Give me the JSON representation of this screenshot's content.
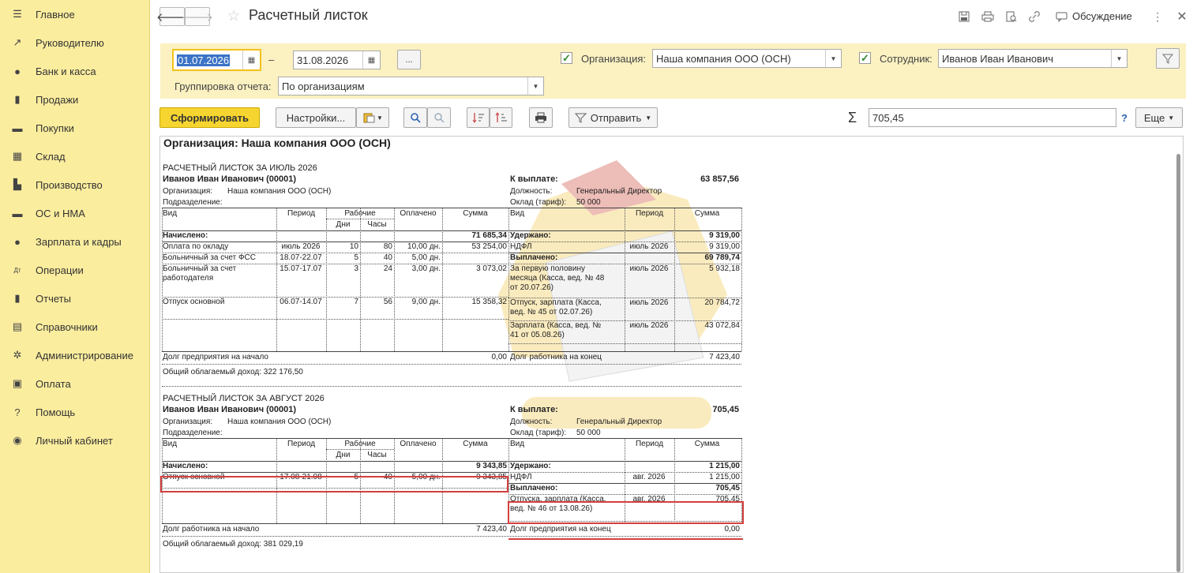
{
  "sidebar": {
    "items": [
      {
        "label": "Главное",
        "icon": "menu-icon"
      },
      {
        "label": "Руководителю",
        "icon": "trend-icon"
      },
      {
        "label": "Банк и касса",
        "icon": "coin-icon"
      },
      {
        "label": "Продажи",
        "icon": "bag-icon"
      },
      {
        "label": "Покупки",
        "icon": "cart-icon"
      },
      {
        "label": "Склад",
        "icon": "warehouse-icon"
      },
      {
        "label": "Производство",
        "icon": "factory-icon"
      },
      {
        "label": "ОС и НМА",
        "icon": "truck-icon"
      },
      {
        "label": "Зарплата и кадры",
        "icon": "person-icon"
      },
      {
        "label": "Операции",
        "icon": "debit-credit-icon"
      },
      {
        "label": "Отчеты",
        "icon": "bar-chart-icon"
      },
      {
        "label": "Справочники",
        "icon": "books-icon"
      },
      {
        "label": "Администрирование",
        "icon": "gear-icon"
      },
      {
        "label": "Оплата",
        "icon": "wallet-icon"
      },
      {
        "label": "Помощь",
        "icon": "question-icon"
      },
      {
        "label": "Личный кабинет",
        "icon": "user-circle-icon"
      }
    ]
  },
  "header": {
    "title": "Расчетный листок",
    "discussion": "Обсуждение"
  },
  "filters": {
    "date_from": "01.07.2026",
    "date_to": "31.08.2026",
    "dash": "–",
    "dots": "...",
    "org_label": "Организация:",
    "org_value": "Наша компания ООО (ОСН)",
    "emp_label": "Сотрудник:",
    "emp_value": "Иванов Иван Иванович",
    "group_label": "Группировка отчета:",
    "group_value": "По организациям"
  },
  "toolbar": {
    "generate": "Сформировать",
    "settings": "Настройки...",
    "send": "Отправить",
    "sum_symbol": "Σ",
    "sum_value": "705,45",
    "help": "?",
    "more": "Еще"
  },
  "report": {
    "org_header": "Организация: Наша компания ООО (ОСН)",
    "col_type": "Вид",
    "col_period": "Период",
    "col_work": "Рабочие",
    "col_days": "Дни",
    "col_hours": "Часы",
    "col_paid": "Оплачено",
    "col_sum": "Сумма",
    "to_pay_label": "К выплате:",
    "position_label": "Должность:",
    "position_value": "Генеральный Директор",
    "salary_label": "Оклад (тариф):",
    "salary_value": "50 000",
    "org_label": "Организация:",
    "org_value": "Наша компания ООО (ОСН)",
    "dept_label": "Подразделение:",
    "accrued": "Начислено:",
    "withheld": "Удержано:",
    "paid_out": "Выплачено:",
    "july": {
      "title": "РАСЧЕТНЫЙ ЛИСТОК ЗА ИЮЛЬ 2026",
      "employee": "Иванов Иван Иванович (00001)",
      "to_pay": "63 857,56",
      "accrued_total": "71 685,34",
      "withheld_total": "9 319,00",
      "paid_total": "69 789,74",
      "left": [
        {
          "type": "Оплата по окладу",
          "period": "июль 2026",
          "days": "10",
          "hours": "80",
          "paid": "10,00 дн.",
          "sum": "53 254,00"
        },
        {
          "type": "Больничный за счет ФСС",
          "period": "18.07-22.07",
          "days": "5",
          "hours": "40",
          "paid": "5,00 дн.",
          "sum": ""
        },
        {
          "type": "Больничный за счет",
          "type2": "работодателя",
          "period": "15.07-17.07",
          "days": "3",
          "hours": "24",
          "paid": "3,00 дн.",
          "sum": "3 073,02"
        },
        {
          "type": "Отпуск основной",
          "period": "06.07-14.07",
          "days": "7",
          "hours": "56",
          "paid": "9,00 дн.",
          "sum": "15 358,32"
        }
      ],
      "ndfl": {
        "type": "НДФЛ",
        "period": "июль 2026",
        "sum": "9 319,00"
      },
      "payments": [
        {
          "l1": "За первую половину",
          "l2": "месяца (Касса, вед. № 48",
          "l3": "от 20.07.26)",
          "period": "июль 2026",
          "sum": "5 932,18"
        },
        {
          "l1": "Отпуск, зарплата (Касса,",
          "l2": "вед. № 45 от 02.07.26)",
          "period": "июль 2026",
          "sum": "20 784,72"
        },
        {
          "l1": "Зарплата (Касса, вед. №",
          "l2": "41 от 05.08.26)",
          "period": "июль 2026",
          "sum": "43 072,84"
        }
      ],
      "debt_start_label": "Долг предприятия на начало",
      "debt_start": "0,00",
      "debt_end_label": "Долг работника на конец",
      "debt_end": "7 423,40",
      "income": "Общий облагаемый доход: 322 176,50"
    },
    "august": {
      "title": "РАСЧЕТНЫЙ ЛИСТОК ЗА АВГУСТ 2026",
      "employee": "Иванов Иван Иванович (00001)",
      "to_pay": "705,45",
      "accrued_total": "9 343,85",
      "withheld_total": "1 215,00",
      "paid_total": "705,45",
      "left": [
        {
          "type": "Отпуск основной",
          "period": "17.08-21.08",
          "days": "5",
          "hours": "40",
          "paid": "5,00 дн.",
          "sum": "9 343,85"
        }
      ],
      "ndfl": {
        "type": "НДФЛ",
        "period": "авг. 2026",
        "sum": "1 215,00"
      },
      "payments": [
        {
          "l1": "Отпуска, зарплата (Касса,",
          "l2": "вед. № 46 от 13.08.26)",
          "period": "авг. 2026",
          "sum": "705,45"
        }
      ],
      "debt_start_label": "Долг работника на начало",
      "debt_start": "7 423,40",
      "debt_end_label": "Долг предприятия на конец",
      "debt_end": "0,00",
      "income": "Общий облагаемый доход: 381 029,19"
    }
  }
}
